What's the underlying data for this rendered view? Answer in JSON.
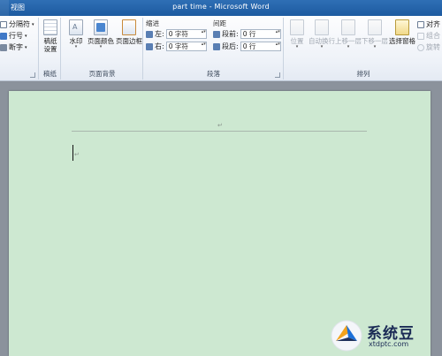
{
  "window": {
    "title": "part time - Microsoft Word",
    "view_tab": "视图"
  },
  "ribbon": {
    "page_setup": {
      "breaks": "分隔符",
      "line_numbers": "行号",
      "hyphenation": "断字",
      "launcher": "⊡"
    },
    "manuscript": {
      "button_line1": "稿纸",
      "button_line2": "设置",
      "group_label": "稿纸"
    },
    "page_background": {
      "watermark": "水印",
      "page_color": "页面颜色",
      "page_borders": "页面边框",
      "group_label": "页面背景"
    },
    "paragraph": {
      "indent_title": "缩进",
      "left_label": "左:",
      "left_value": "0 字符",
      "right_label": "右:",
      "right_value": "0 字符",
      "spacing_title": "间距",
      "before_label": "段前:",
      "before_value": "0 行",
      "after_label": "段后:",
      "after_value": "0 行",
      "group_label": "段落"
    },
    "arrange": {
      "position": "位置",
      "wrap_text": "自动换行",
      "bring_forward": "上移一层",
      "send_backward": "下移一层",
      "selection_pane": "选择窗格",
      "align": "对齐",
      "group": "组合",
      "rotate": "旋转",
      "group_label": "排列"
    }
  },
  "document": {
    "para_mark": "↵"
  },
  "watermark_logo": {
    "cn": "系统豆",
    "en": "xtdptc.com"
  },
  "colors": {
    "page_bg": "#cde8d1",
    "title_bar": "#1d5aa0",
    "workspace": "#8b929c"
  }
}
